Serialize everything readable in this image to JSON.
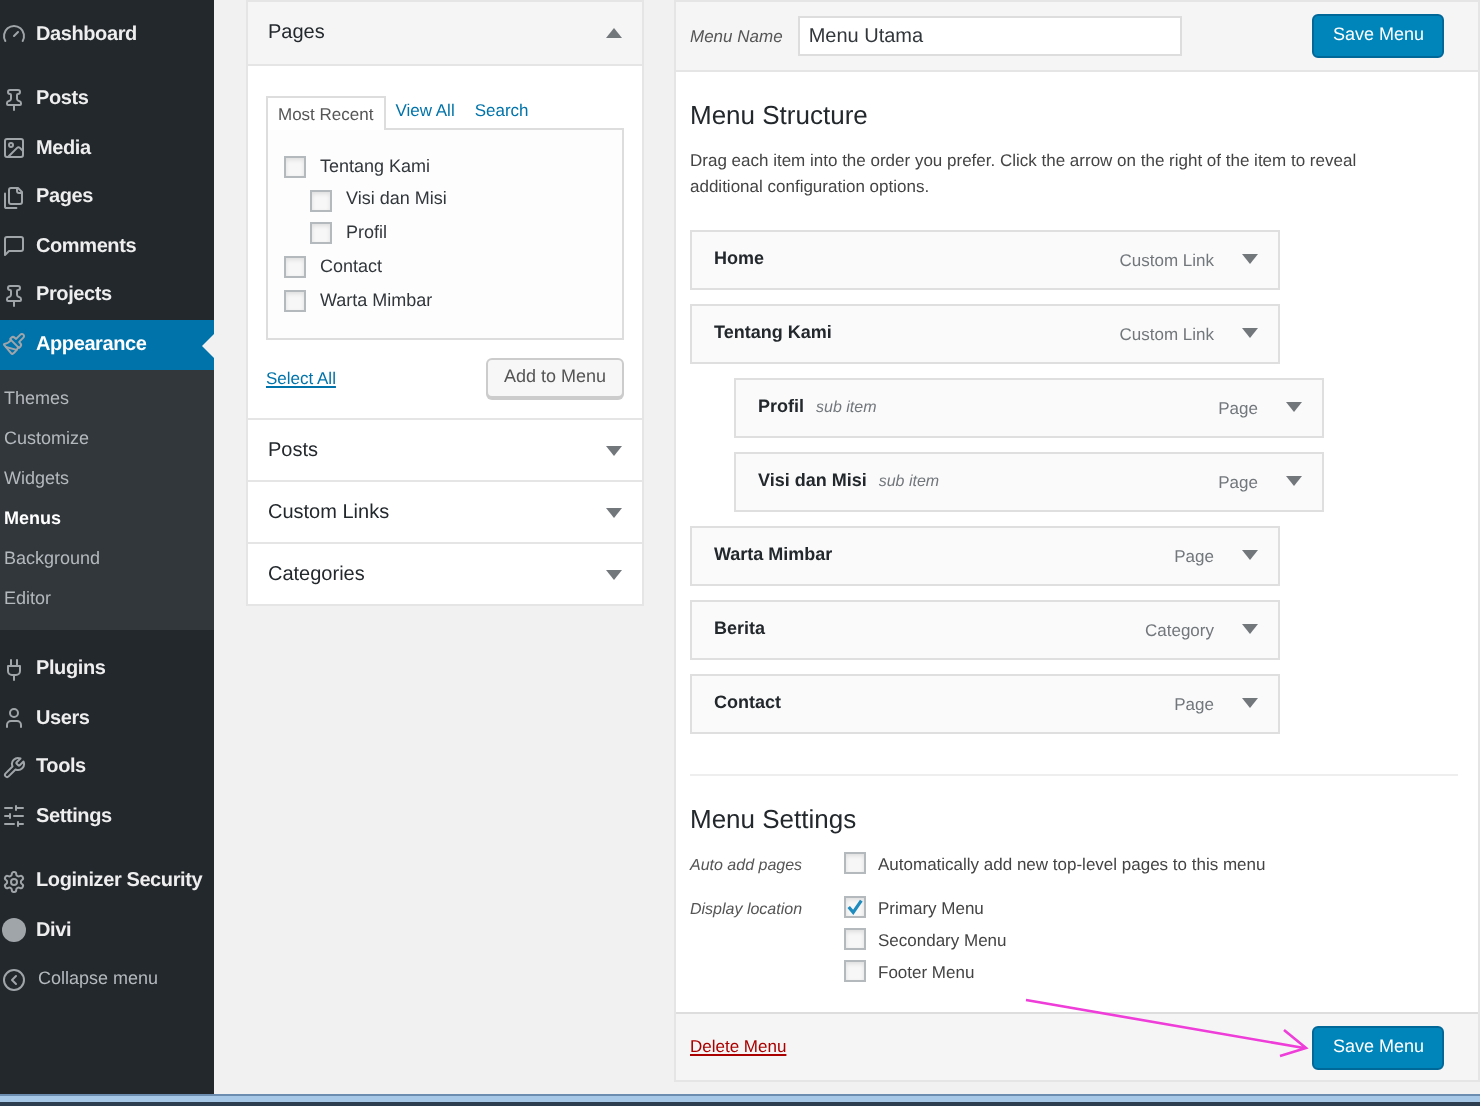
{
  "sidebar": {
    "items": [
      {
        "label": "Dashboard",
        "selected": false
      },
      {
        "label": "Posts",
        "selected": false
      },
      {
        "label": "Media",
        "selected": false
      },
      {
        "label": "Pages",
        "selected": false
      },
      {
        "label": "Comments",
        "selected": false
      },
      {
        "label": "Projects",
        "selected": false
      },
      {
        "label": "Appearance",
        "selected": true,
        "submenu": [
          {
            "label": "Themes",
            "selected": false
          },
          {
            "label": "Customize",
            "selected": false
          },
          {
            "label": "Widgets",
            "selected": false
          },
          {
            "label": "Menus",
            "selected": true
          },
          {
            "label": "Background",
            "selected": false
          },
          {
            "label": "Editor",
            "selected": false
          }
        ]
      },
      {
        "label": "Plugins",
        "selected": false
      },
      {
        "label": "Users",
        "selected": false
      },
      {
        "label": "Tools",
        "selected": false
      },
      {
        "label": "Settings",
        "selected": false
      },
      {
        "label": "Loginizer Security",
        "selected": false
      },
      {
        "label": "Divi",
        "selected": false
      }
    ],
    "collapse_label": "Collapse menu"
  },
  "add_items": {
    "sections": [
      {
        "title": "Pages",
        "expanded": true,
        "tabs": [
          {
            "label": "Most Recent",
            "selected": true
          },
          {
            "label": "View All",
            "selected": false
          },
          {
            "label": "Search",
            "selected": false
          }
        ],
        "items": [
          {
            "label": "Tentang Kami",
            "checked": false,
            "children": [
              {
                "label": "Visi dan Misi",
                "checked": false
              },
              {
                "label": "Profil",
                "checked": false
              }
            ]
          },
          {
            "label": "Contact",
            "checked": false
          },
          {
            "label": "Warta Mimbar",
            "checked": false
          }
        ],
        "select_all": "Select All",
        "add_button": "Add to Menu"
      },
      {
        "title": "Posts",
        "expanded": false
      },
      {
        "title": "Custom Links",
        "expanded": false
      },
      {
        "title": "Categories",
        "expanded": false
      }
    ]
  },
  "menu_editor": {
    "menu_name_label": "Menu Name",
    "menu_name_value": "Menu Utama",
    "save_button": "Save Menu",
    "structure_title": "Menu Structure",
    "structure_help": "Drag each item into the order you prefer. Click the arrow on the right of the item to reveal additional configuration options.",
    "items": [
      {
        "title": "Home",
        "type": "Custom Link"
      },
      {
        "title": "Tentang Kami",
        "type": "Custom Link",
        "children": [
          {
            "title": "Profil",
            "note": "sub item",
            "type": "Page"
          },
          {
            "title": "Visi dan Misi",
            "note": "sub item",
            "type": "Page"
          }
        ]
      },
      {
        "title": "Warta Mimbar",
        "type": "Page"
      },
      {
        "title": "Berita",
        "type": "Category"
      },
      {
        "title": "Contact",
        "type": "Page"
      }
    ],
    "settings_title": "Menu Settings",
    "settings": [
      {
        "label": "Auto add pages",
        "options": [
          {
            "label": "Automatically add new top-level pages to this menu",
            "checked": false
          }
        ]
      },
      {
        "label": "Display location",
        "options": [
          {
            "label": "Primary Menu",
            "checked": true
          },
          {
            "label": "Secondary Menu",
            "checked": false
          },
          {
            "label": "Footer Menu",
            "checked": false
          }
        ]
      }
    ],
    "delete_link": "Delete Menu",
    "footer_save_button": "Save Menu"
  }
}
